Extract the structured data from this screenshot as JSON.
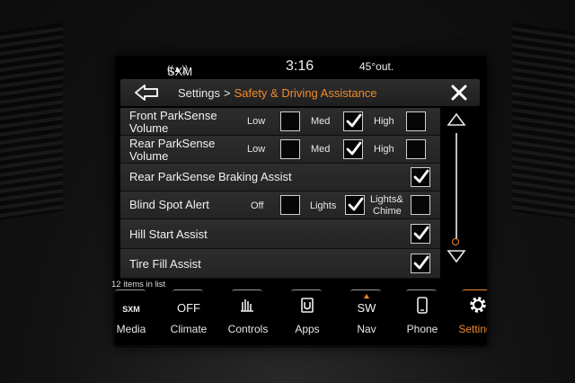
{
  "status": {
    "radio": "SXM 7",
    "time": "3:16",
    "temperature": "45°out."
  },
  "header": {
    "parent": "Settings",
    "separator": ">",
    "current": "Safety & Driving Assistance"
  },
  "rows": [
    {
      "label_line1": "Front ParkSense",
      "label_line2": "Volume",
      "options": [
        {
          "label": "Low",
          "checked": false
        },
        {
          "label": "Med",
          "checked": true
        },
        {
          "label": "High",
          "checked": false
        }
      ]
    },
    {
      "label_line1": "Rear ParkSense",
      "label_line2": "Volume",
      "options": [
        {
          "label": "Low",
          "checked": false
        },
        {
          "label": "Med",
          "checked": true
        },
        {
          "label": "High",
          "checked": false
        }
      ]
    },
    {
      "label": "Rear ParkSense Braking Assist",
      "checked": true
    },
    {
      "label": "Blind Spot Alert",
      "options": [
        {
          "label": "Off",
          "checked": false
        },
        {
          "label": "Lights",
          "checked": true
        },
        {
          "label_line1": "Lights&",
          "label_line2": "Chime",
          "checked": false
        }
      ]
    },
    {
      "label": "Hill Start Assist",
      "checked": true
    },
    {
      "label": "Tire Fill Assist",
      "checked": true
    }
  ],
  "list_count": "12 items in list",
  "nav": [
    {
      "label": "Media",
      "icon": "sxm-icon",
      "icon_text": "SXM"
    },
    {
      "label": "Climate",
      "icon": "climate-icon",
      "icon_text": "OFF"
    },
    {
      "label": "Controls",
      "icon": "controls-icon"
    },
    {
      "label": "Apps",
      "icon": "apps-icon"
    },
    {
      "label": "Nav",
      "icon": "compass-icon",
      "icon_text": "SW"
    },
    {
      "label": "Phone",
      "icon": "phone-icon"
    },
    {
      "label": "Settings",
      "icon": "gear-icon",
      "active": true
    }
  ],
  "colors": {
    "accent": "#f08a2a",
    "row_bg": "#2a2a2a",
    "text": "#f2f2f2"
  }
}
